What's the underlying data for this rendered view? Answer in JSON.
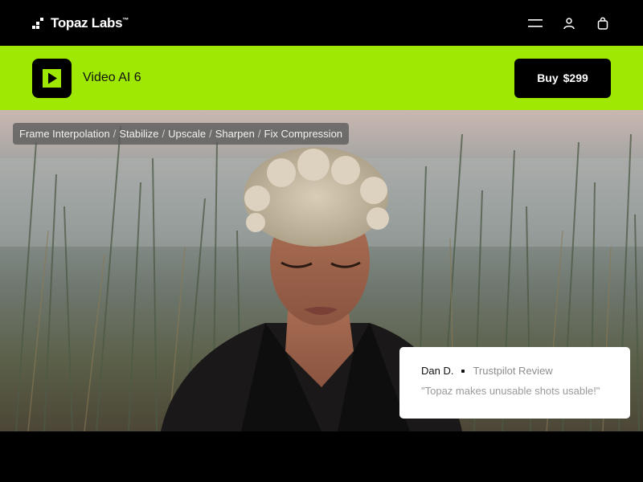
{
  "nav": {
    "brand": "Topaz Labs",
    "trademark": "™",
    "icons": [
      "menu-icon",
      "user-icon",
      "shopping-bag-icon"
    ]
  },
  "product": {
    "name": "Video AI 6",
    "buy_label": "Buy",
    "price": "$299",
    "accent": "#9ee804"
  },
  "hero": {
    "features": [
      "Frame Interpolation",
      "Stabilize",
      "Upscale",
      "Sharpen",
      "Fix Compression"
    ],
    "separator": "/"
  },
  "review": {
    "reviewer": "Dan D.",
    "source": "Trustpilot Review",
    "quote": "\"Topaz makes unusable shots usable!\""
  }
}
